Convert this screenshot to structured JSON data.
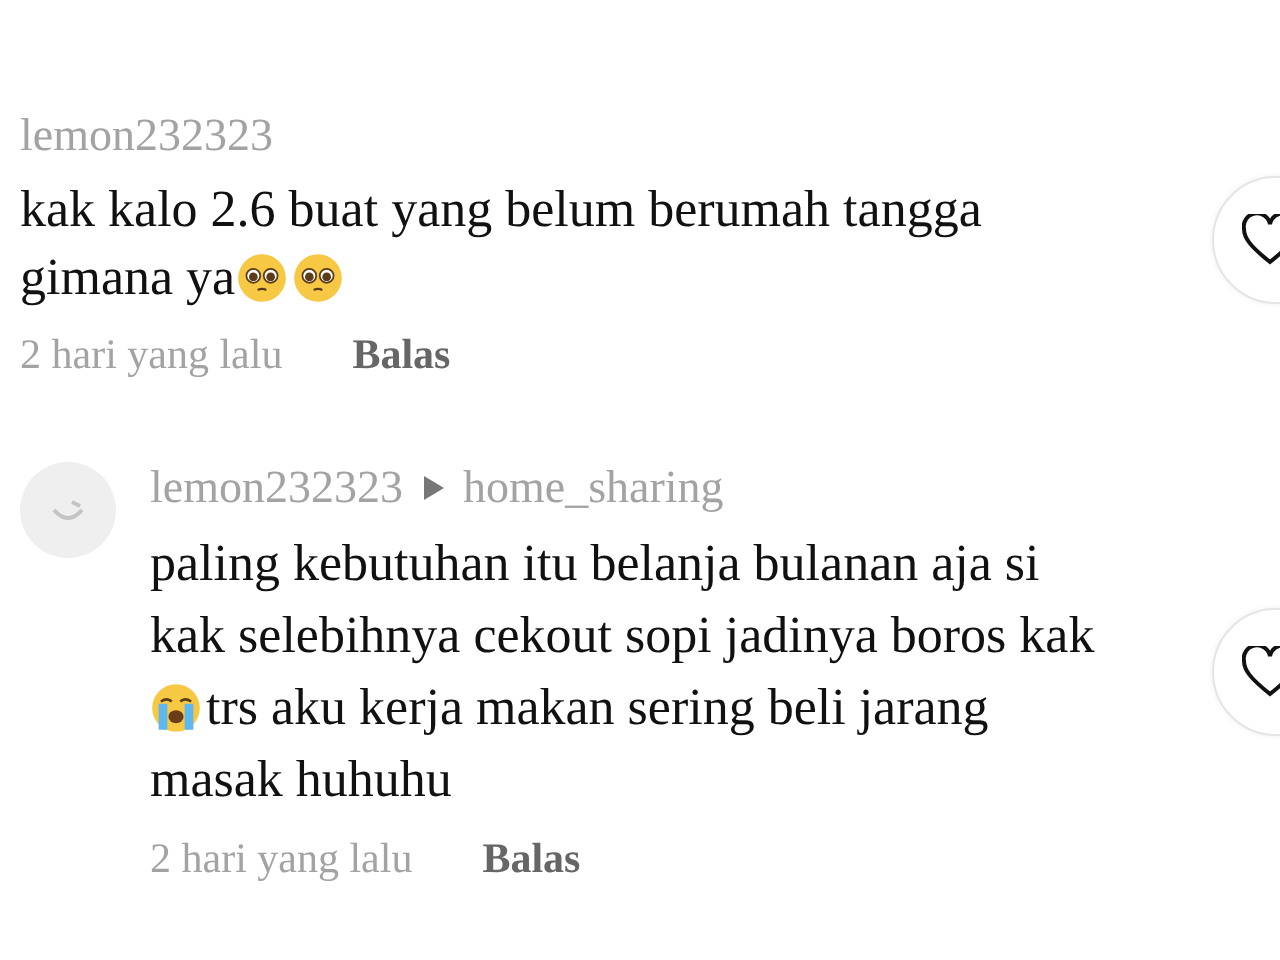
{
  "comments": [
    {
      "username": "lemon232323",
      "avatar": false,
      "lines": [
        [
          {
            "kind": "text",
            "text": "kak kalo 2.6 buat yang belum berumah tangga"
          }
        ],
        [
          {
            "kind": "text",
            "text": "gimana ya"
          },
          {
            "kind": "pleading-face"
          },
          {
            "kind": "pleading-face"
          }
        ]
      ],
      "time": "2 hari yang lalu",
      "reply_label": "Balas",
      "liked": false
    },
    {
      "username": "lemon232323",
      "reply_to": "home_sharing",
      "avatar": true,
      "lines": [
        [
          {
            "kind": "text",
            "text": "paling kebutuhan itu belanja bulanan aja si"
          }
        ],
        [
          {
            "kind": "text",
            "text": "kak selebihnya cekout sopi jadinya boros kak"
          }
        ],
        [
          {
            "kind": "crying-face"
          },
          {
            "kind": "text",
            "text": "trs aku kerja makan sering beli jarang"
          }
        ],
        [
          {
            "kind": "text",
            "text": "masak huhuhu"
          }
        ]
      ],
      "time": "2 hari yang lalu",
      "reply_label": "Balas",
      "liked": false
    }
  ]
}
